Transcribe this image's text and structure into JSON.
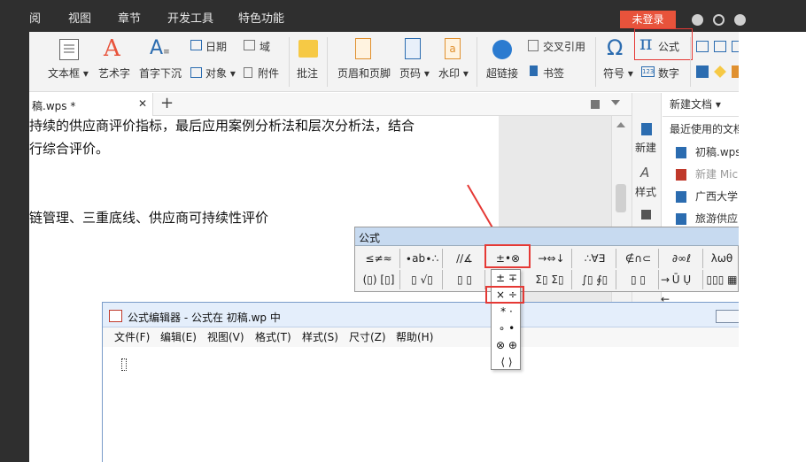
{
  "menu_tabs": [
    "阅",
    "视图",
    "章节",
    "开发工具",
    "特色功能"
  ],
  "login_label": "未登录",
  "ribbon": {
    "textbox": "文本框",
    "wordart": "艺术字",
    "dropcap": "首字下沉",
    "date": "日期",
    "field": "域",
    "object": "对象",
    "attachment": "附件",
    "comment": "批注",
    "header_footer": "页眉和页脚",
    "page_number": "页码",
    "watermark": "水印",
    "hyperlink": "超链接",
    "crossref": "交叉引用",
    "bookmark": "书签",
    "symbol": "符号",
    "formula": "公式",
    "number": "数字",
    "formula_glyph": "π",
    "symbol_glyph": "Ω"
  },
  "doc_tab": {
    "title": "稿.wps *",
    "close": "✕",
    "add": "+"
  },
  "document": {
    "line1": "持续的供应商评价指标，最后应用案例分析法和层次分析法，结合",
    "line2": "行综合评价。",
    "line3": "链管理、三重底线、供应商可持续性评价"
  },
  "side_tools": {
    "new": "新建",
    "style": "样式"
  },
  "right_panel": {
    "new_doc": "新建文档",
    "recent": "最近使用的文档",
    "files": [
      "初稿.wps",
      "新建 Mic",
      "广西大学",
      "旅游供应"
    ]
  },
  "palette": {
    "title": "公式",
    "row1": [
      "≤≠≈",
      "∙ab∙∴",
      "∕∕∡",
      "±•⊗",
      "→⇔↓",
      "∴∀∃",
      "∉∩⊂",
      "∂∞ℓ",
      "λωθ"
    ],
    "row2": [
      "(▯) [▯]",
      "▯ √▯",
      "▯ ▯",
      "Σ▯ Σ▯",
      "∫▯ ∮▯",
      "▯ ▯",
      "→ ←",
      "Ū Ụ",
      "▯▯▯ ▦"
    ],
    "dropdown": [
      "± ∓",
      "× ÷",
      "* ·",
      "∘ •",
      "⊗ ⊕",
      "⟨ ⟩"
    ]
  },
  "editor": {
    "title": "公式编辑器 - 公式在 初稿.wp 中",
    "menus": [
      "文件(F)",
      "编辑(E)",
      "视图(V)",
      "格式(T)",
      "样式(S)",
      "尺寸(Z)",
      "帮助(H)"
    ]
  },
  "colors": {
    "accent": "#e8533b",
    "annotation": "#e53935",
    "titlebar": "#2f2f2f"
  }
}
